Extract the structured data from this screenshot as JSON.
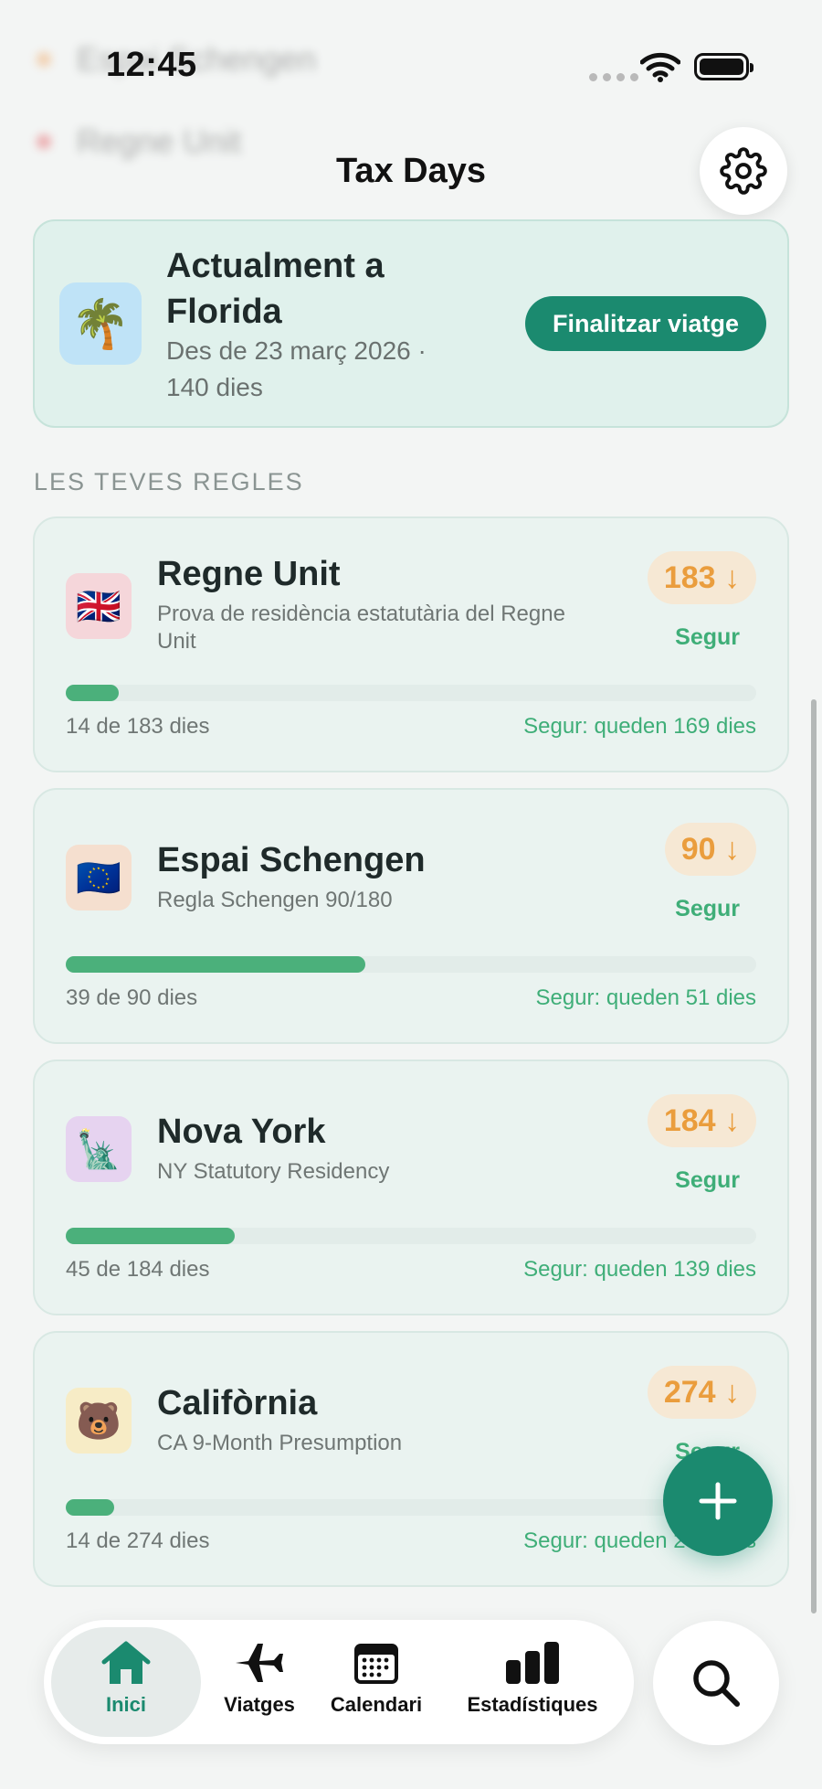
{
  "status_bar": {
    "time": "12:45"
  },
  "ghost_rows": [
    {
      "label": "Espai Schengen",
      "color": "#f0a15a"
    },
    {
      "label": "Regne Unit",
      "color": "#e2545a"
    }
  ],
  "header": {
    "title": "Tax Days"
  },
  "current_trip": {
    "emoji": "🌴",
    "title": "Actualment a Florida",
    "subtitle": "Des de 23 març 2026 · 140 dies",
    "end_button": "Finalitzar viatge"
  },
  "section_label": "LES TEVES REGLES",
  "rules": [
    {
      "emoji": "🇬🇧",
      "icon_bg": "#f5d6da",
      "name": "Regne Unit",
      "description": "Prova de residència estatutària del Regne Unit",
      "limit": "183 ↓",
      "status": "Segur",
      "used": 14,
      "max": 183,
      "count": "14 de 183 dies",
      "remaining": "Segur: queden 169 dies"
    },
    {
      "emoji": "🇪🇺",
      "icon_bg": "#f5dfcf",
      "name": "Espai Schengen",
      "description": "Regla Schengen 90/180",
      "limit": "90 ↓",
      "status": "Segur",
      "used": 39,
      "max": 90,
      "count": "39 de 90 dies",
      "remaining": "Segur: queden 51 dies"
    },
    {
      "emoji": "🗽",
      "icon_bg": "#e6d3f0",
      "name": "Nova York",
      "description": "NY Statutory Residency",
      "limit": "184 ↓",
      "status": "Segur",
      "used": 45,
      "max": 184,
      "count": "45 de 184 dies",
      "remaining": "Segur: queden 139 dies"
    },
    {
      "emoji": "🐻",
      "icon_bg": "#f7ecc6",
      "name": "Califòrnia",
      "description": "CA 9-Month Presumption",
      "limit": "274 ↓",
      "status": "Segur",
      "used": 14,
      "max": 274,
      "count": "14 de 274 dies",
      "remaining": "Segur: queden 260 dies"
    }
  ],
  "tabs": [
    {
      "label": "Inici",
      "icon": "home-icon",
      "active": true
    },
    {
      "label": "Viatges",
      "icon": "airplane-icon",
      "active": false
    },
    {
      "label": "Calendari",
      "icon": "calendar-icon",
      "active": false
    },
    {
      "label": "Estadístiques",
      "icon": "bar-chart-icon",
      "active": false
    }
  ],
  "colors": {
    "accent": "#1b8a6f",
    "safe": "#3fae78",
    "warning": "#ea9d3d"
  }
}
